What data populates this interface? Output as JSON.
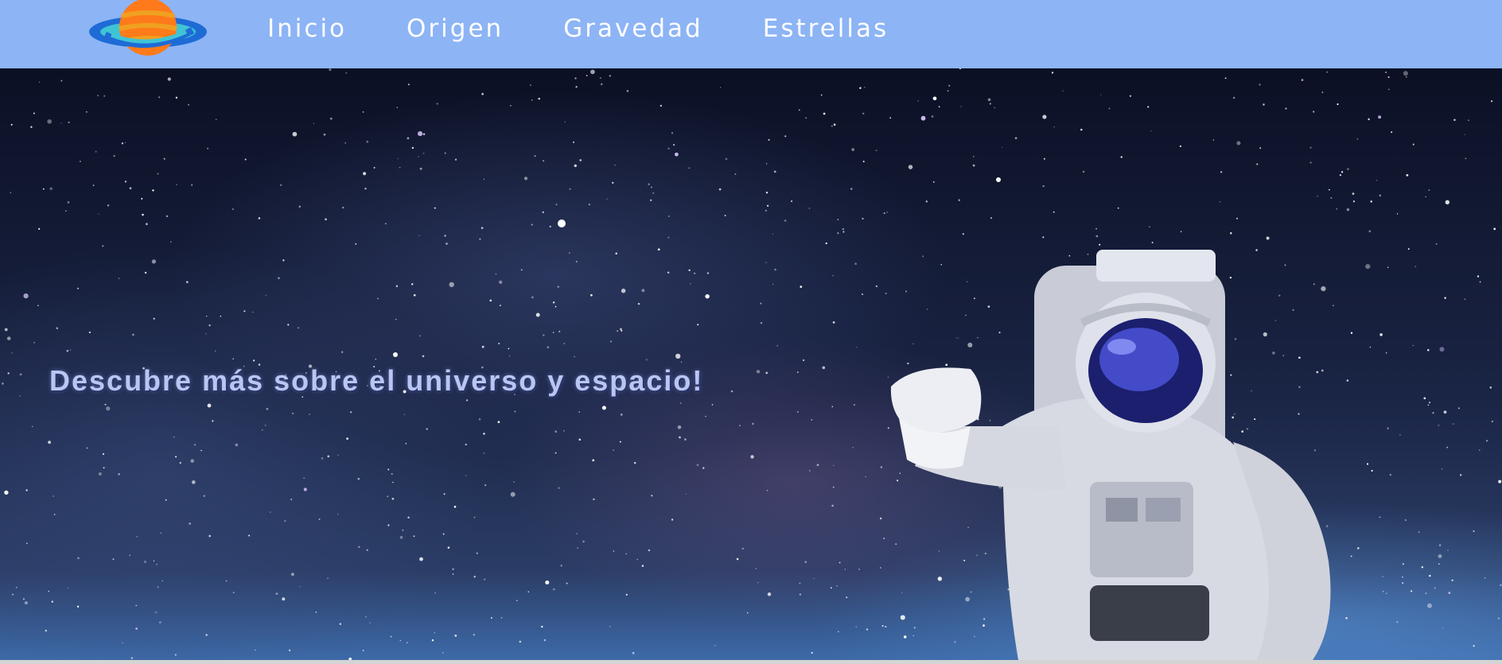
{
  "nav": {
    "logo_icon": "planet-icon",
    "links": [
      {
        "label": "Inicio"
      },
      {
        "label": "Origen"
      },
      {
        "label": "Gravedad"
      },
      {
        "label": "Estrellas"
      }
    ]
  },
  "hero": {
    "title": "Descubre más sobre el universo y espacio!",
    "background_image": "starry-space-galaxy",
    "figure": "astronaut-image"
  },
  "colors": {
    "nav_background": "#8db4f5",
    "nav_text": "#ffffff",
    "title_text": "#b9c6f3",
    "planet_orange": "#ff7a1a",
    "planet_ring": "#1e6bd6"
  }
}
